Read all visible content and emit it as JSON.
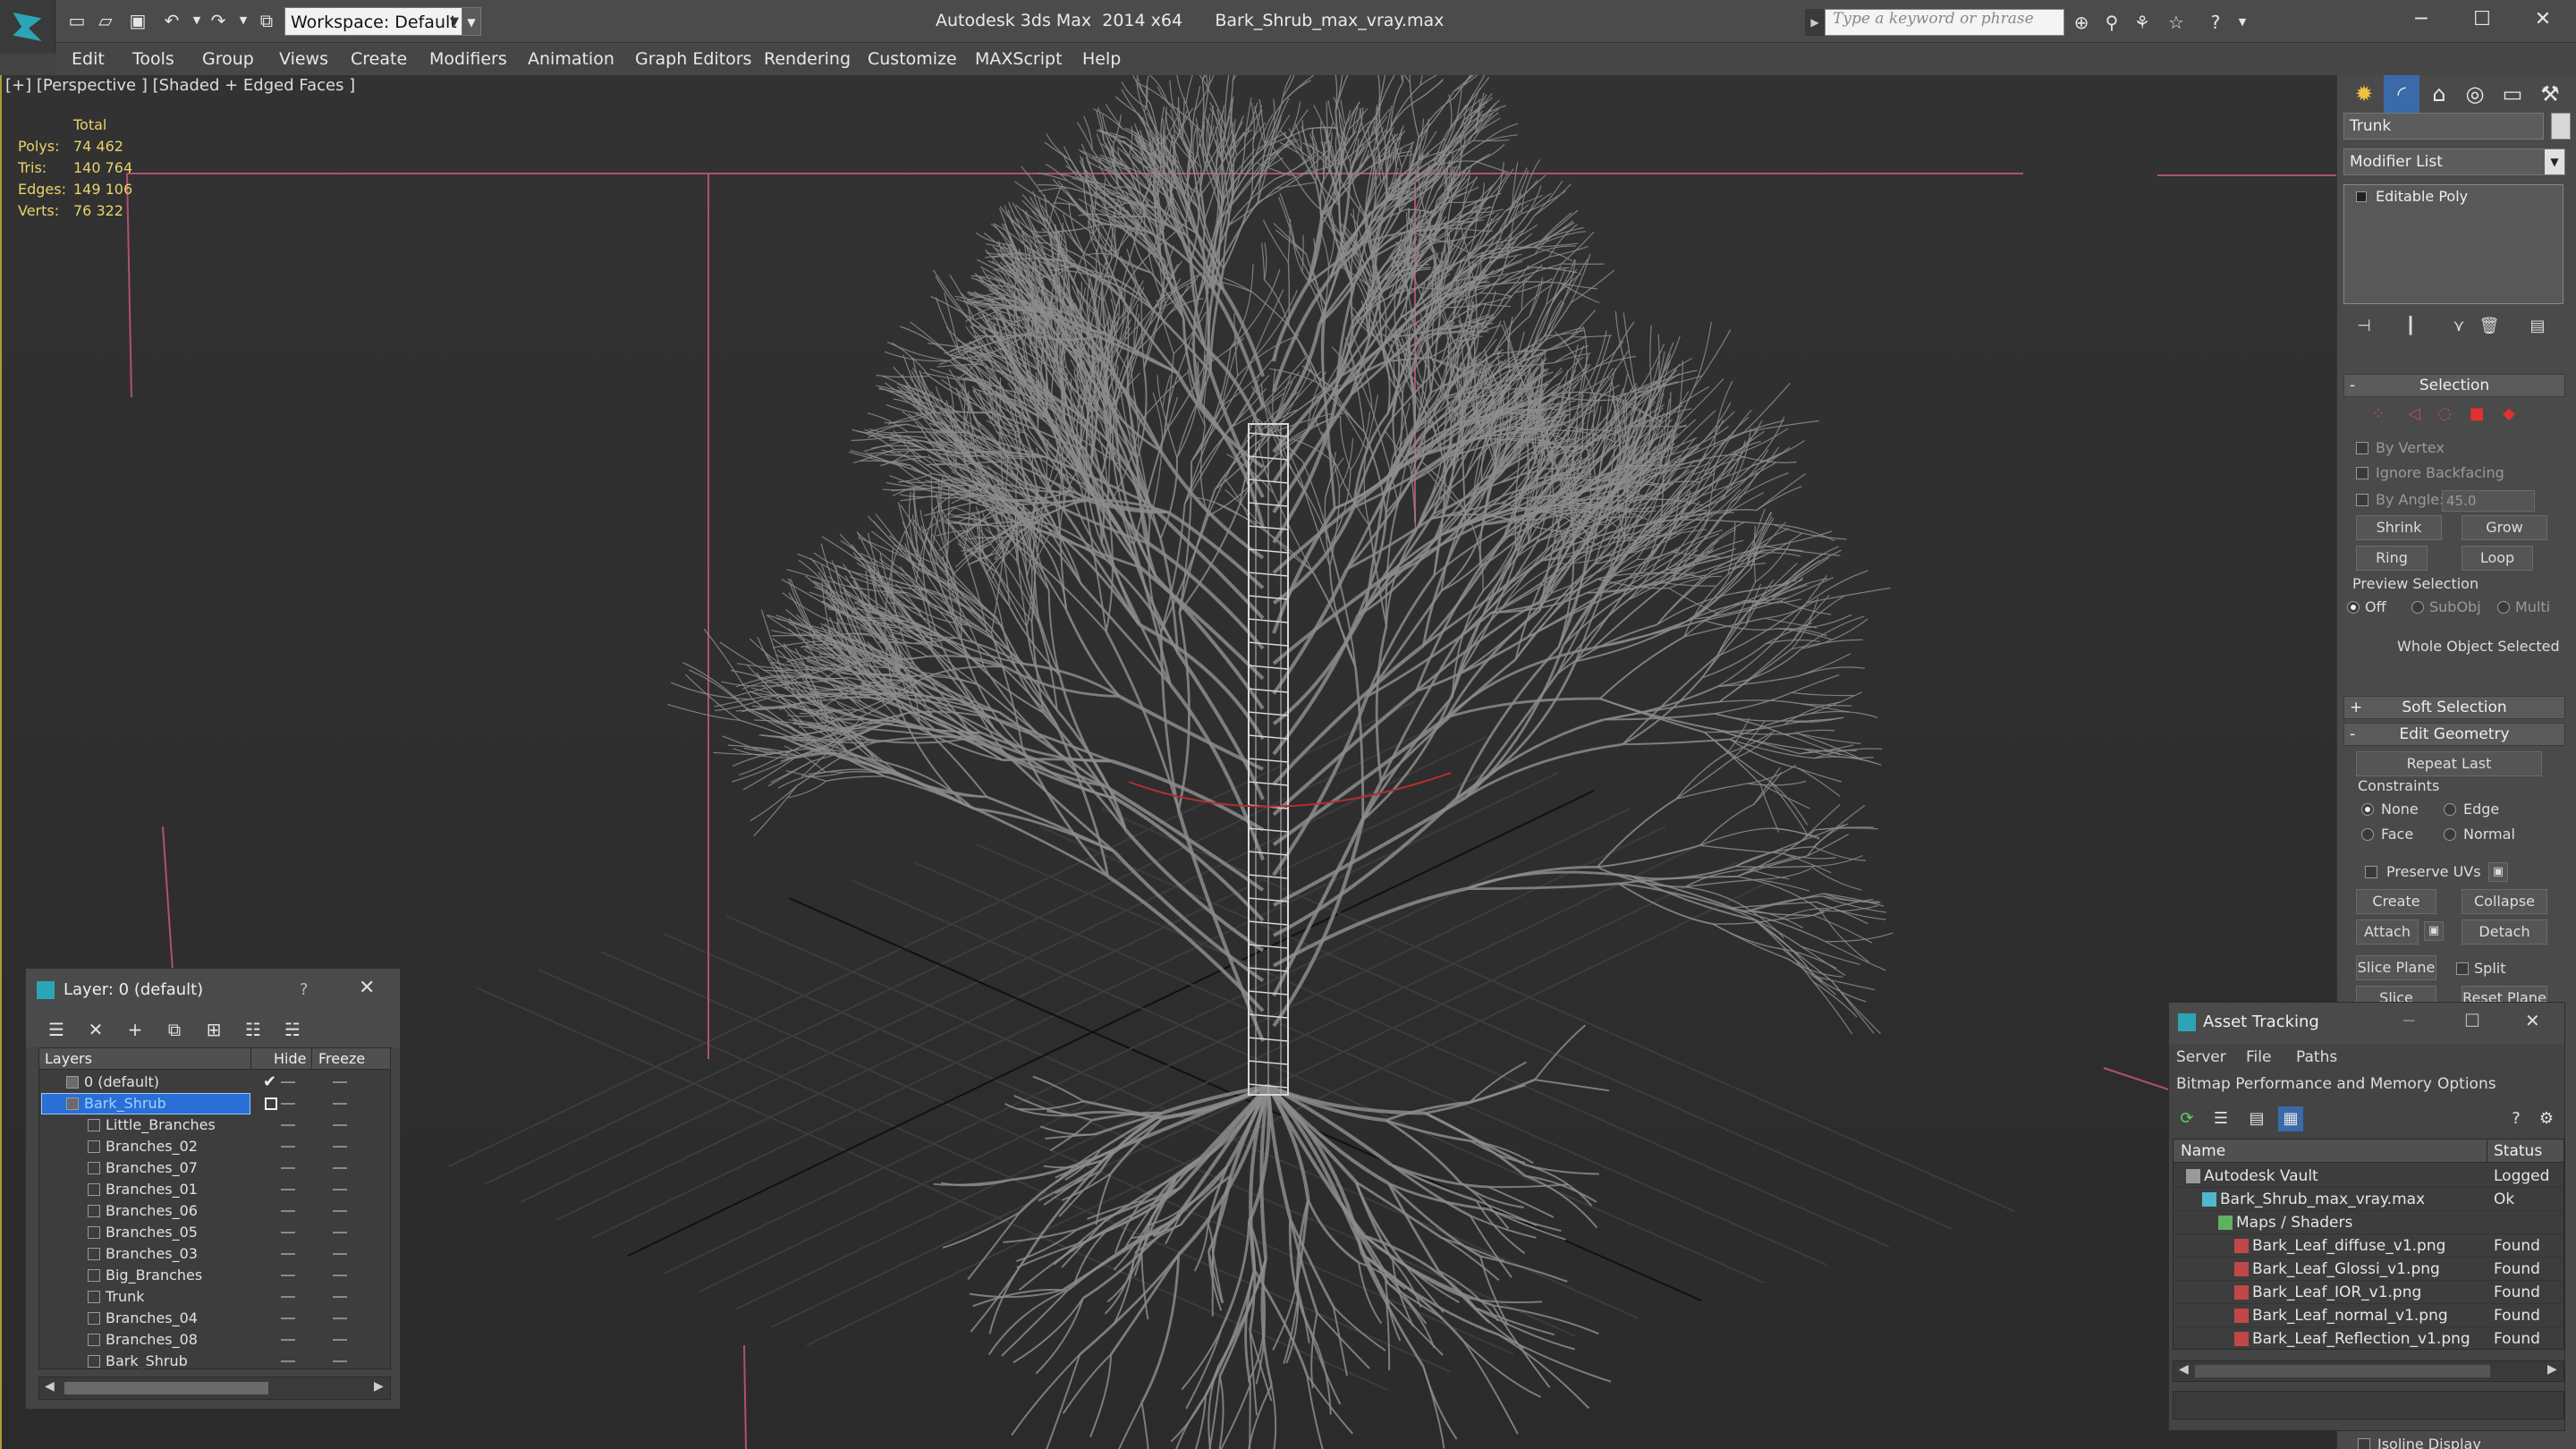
{
  "app": {
    "title": "Autodesk 3ds Max  2014 x64",
    "file": "Bark_Shrub_max_vray.max",
    "workspace": "Workspace: Default",
    "search_placeholder": "Type a keyword or phrase"
  },
  "menu": [
    "Edit",
    "Tools",
    "Group",
    "Views",
    "Create",
    "Modifiers",
    "Animation",
    "Graph Editors",
    "Rendering",
    "Customize",
    "MAXScript",
    "Help"
  ],
  "viewport": {
    "label": "[+] [Perspective ] [Shaded + Edged Faces ]",
    "stats": {
      "header": "Total",
      "rows": [
        {
          "label": "Polys:",
          "value": "74 462"
        },
        {
          "label": "Tris:",
          "value": "140 764"
        },
        {
          "label": "Edges:",
          "value": "149 106"
        },
        {
          "label": "Verts:",
          "value": "76 322"
        }
      ]
    }
  },
  "command_panel": {
    "object_name": "Trunk",
    "modifier_list": "Modifier List",
    "stack_item": "Editable Poly",
    "selection": {
      "title": "Selection",
      "by_vertex": "By Vertex",
      "ignore_backfacing": "Ignore Backfacing",
      "by_angle": "By Angle:",
      "angle_value": "45.0",
      "shrink": "Shrink",
      "grow": "Grow",
      "ring": "Ring",
      "loop": "Loop",
      "preview_selection": "Preview Selection",
      "off": "Off",
      "subobj": "SubObj",
      "multi": "Multi",
      "status": "Whole Object Selected"
    },
    "soft_selection": "Soft Selection",
    "edit_geometry": {
      "title": "Edit Geometry",
      "repeat_last": "Repeat Last",
      "constraints": "Constraints",
      "none": "None",
      "edge": "Edge",
      "face": "Face",
      "normal": "Normal",
      "preserve_uvs": "Preserve UVs",
      "create": "Create",
      "collapse": "Collapse",
      "attach": "Attach",
      "detach": "Detach",
      "slice_plane": "Slice Plane",
      "split": "Split",
      "slice": "Slice",
      "reset_plane": "Reset Plane",
      "isoline_display": "Isoline Display"
    }
  },
  "layer_window": {
    "title": "Layer: 0 (default)",
    "help": "?",
    "columns": {
      "layers": "Layers",
      "hide": "Hide",
      "freeze": "Freeze"
    },
    "rows": [
      {
        "name": "0 (default)",
        "level": 0,
        "state": "check"
      },
      {
        "name": "Bark_Shrub",
        "level": 0,
        "state": "active",
        "selected": true
      },
      {
        "name": "Little_Branches",
        "level": 1
      },
      {
        "name": "Branches_02",
        "level": 1
      },
      {
        "name": "Branches_07",
        "level": 1
      },
      {
        "name": "Branches_01",
        "level": 1
      },
      {
        "name": "Branches_06",
        "level": 1
      },
      {
        "name": "Branches_05",
        "level": 1
      },
      {
        "name": "Branches_03",
        "level": 1
      },
      {
        "name": "Big_Branches",
        "level": 1
      },
      {
        "name": "Trunk",
        "level": 1
      },
      {
        "name": "Branches_04",
        "level": 1
      },
      {
        "name": "Branches_08",
        "level": 1
      },
      {
        "name": "Bark_Shrub",
        "level": 1
      }
    ]
  },
  "asset_window": {
    "title": "Asset Tracking",
    "menu1": [
      "Server",
      "File",
      "Paths"
    ],
    "menu2": [
      "Bitmap Performance and Memory",
      "Options"
    ],
    "columns": {
      "name": "Name",
      "status": "Status"
    },
    "rows": [
      {
        "name": "Autodesk Vault",
        "level": 0,
        "status": "Logged",
        "icon": "vault"
      },
      {
        "name": "Bark_Shrub_max_vray.max",
        "level": 1,
        "status": "Ok",
        "icon": "max"
      },
      {
        "name": "Maps / Shaders",
        "level": 2,
        "status": "",
        "icon": "maps"
      },
      {
        "name": "Bark_Leaf_diffuse_v1.png",
        "level": 3,
        "status": "Found",
        "icon": "png"
      },
      {
        "name": "Bark_Leaf_Glossi_v1.png",
        "level": 3,
        "status": "Found",
        "icon": "png"
      },
      {
        "name": "Bark_Leaf_IOR_v1.png",
        "level": 3,
        "status": "Found",
        "icon": "png"
      },
      {
        "name": "Bark_Leaf_normal_v1.png",
        "level": 3,
        "status": "Found",
        "icon": "png"
      },
      {
        "name": "Bark_Leaf_Reflection_v1.png",
        "level": 3,
        "status": "Found",
        "icon": "png"
      }
    ]
  },
  "colors": {
    "selection_blue": "#2a6fd6",
    "stat_text": "#e8d36a",
    "app_accent": "#2ba5b5",
    "viewport_border": "#b09a3a",
    "selected_text": "#9fd0ff"
  }
}
